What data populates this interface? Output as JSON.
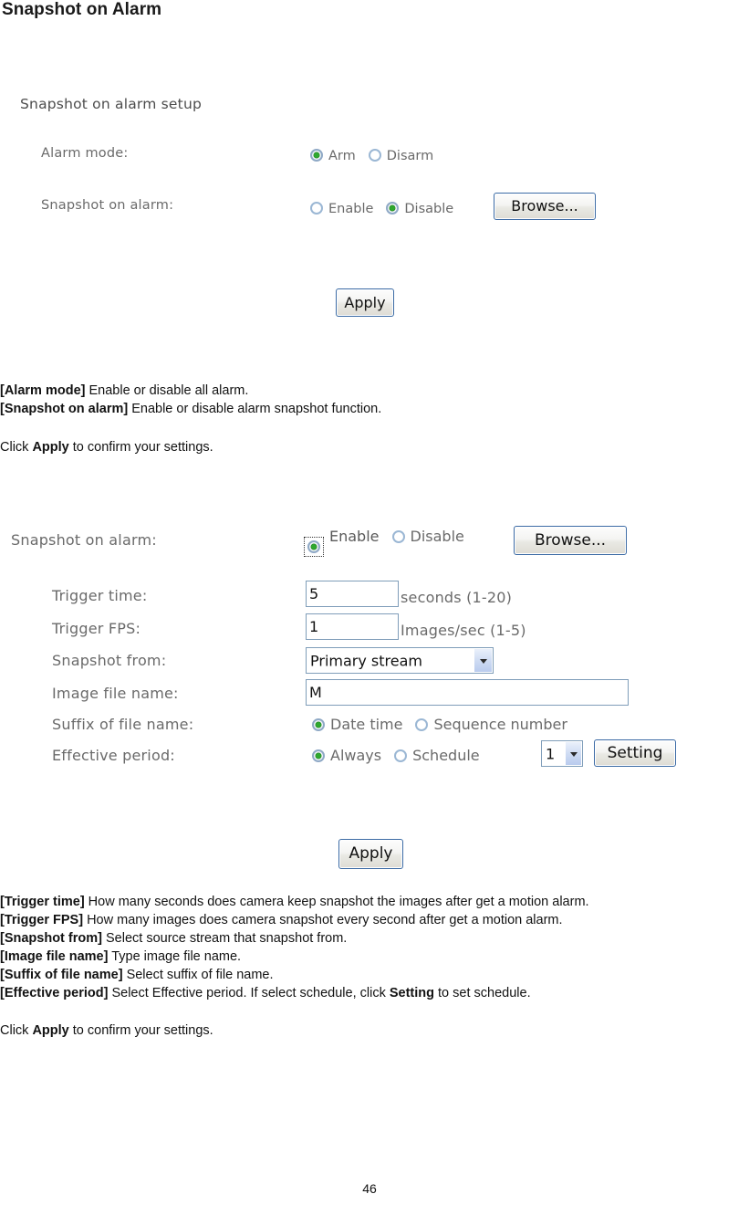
{
  "page": {
    "title": "Snapshot on Alarm",
    "number": "46"
  },
  "section1": {
    "heading": "Snapshot on alarm setup",
    "rows": [
      {
        "label": "Alarm mode:"
      },
      {
        "label": "Snapshot on alarm:"
      }
    ],
    "alarm_mode": {
      "option_arm": "Arm",
      "option_disarm": "Disarm",
      "selected": "Arm"
    },
    "snapshot_on_alarm": {
      "option_enable": "Enable",
      "option_disable": "Disable",
      "selected": "Disable",
      "browse_label": "Browse..."
    },
    "apply_label": "Apply"
  },
  "description1": {
    "line1_term": "[Alarm mode]",
    "line1_text": " Enable or disable all alarm.",
    "line2_term": "[Snapshot on alarm]",
    "line2_text": " Enable or disable alarm snapshot function.",
    "click_prefix": "Click ",
    "click_button": "Apply",
    "click_suffix": " to confirm your settings."
  },
  "section2": {
    "row_snapshot_on_alarm": {
      "label": "Snapshot on alarm:",
      "option_enable": "Enable",
      "option_disable": "Disable",
      "selected": "Enable",
      "browse_label": "Browse..."
    },
    "row_trigger_time": {
      "label": "Trigger time:",
      "value": "5",
      "hint": "seconds (1-20)"
    },
    "row_trigger_fps": {
      "label": "Trigger FPS:",
      "value": "1",
      "hint": "Images/sec (1-5)"
    },
    "row_snapshot_from": {
      "label": "Snapshot from:",
      "value": "Primary stream"
    },
    "row_image_file_name": {
      "label": "Image file name:",
      "value": "M"
    },
    "row_suffix": {
      "label": "Suffix of file name:",
      "option_datetime": "Date time",
      "option_sequence": "Sequence number",
      "selected": "Date time"
    },
    "row_effective_period": {
      "label": "Effective period:",
      "option_always": "Always",
      "option_schedule": "Schedule",
      "selected": "Always",
      "schedule_value": "1",
      "setting_label": "Setting"
    },
    "apply_label": "Apply"
  },
  "description2": {
    "line1_term": "[Trigger time]",
    "line1_text": " How many seconds does camera keep snapshot the images after get a motion alarm.",
    "line2_term": "[Trigger FPS]",
    "line2_text": " How many images does camera snapshot every second after get a motion alarm.",
    "line3_term": "[Snapshot from]",
    "line3_text": " Select source stream that snapshot from.",
    "line4_term": "[Image file name]",
    "line4_text": " Type image file name.",
    "line5_term": "[Suffix of file name]",
    "line5_text": " Select suffix of file name.",
    "line6_term": "[Effective period]",
    "line6_text_a": " Select Effective period. If select schedule, click ",
    "line6_bold": "Setting",
    "line6_text_b": " to set schedule.",
    "click_prefix": "Click ",
    "click_button": "Apply",
    "click_suffix": " to confirm your settings."
  }
}
